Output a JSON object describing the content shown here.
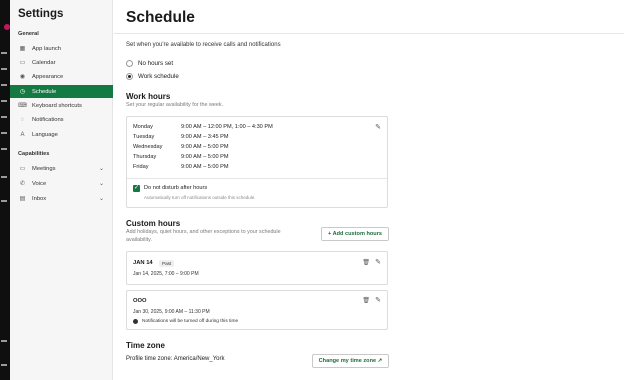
{
  "sidebar": {
    "title": "Settings",
    "sections": [
      {
        "label": "General"
      },
      {
        "label": "Capabilities"
      }
    ],
    "items": [
      {
        "label": "App launch",
        "icon": "grid-icon"
      },
      {
        "label": "Calendar",
        "icon": "calendar-icon"
      },
      {
        "label": "Appearance",
        "icon": "eye-icon"
      },
      {
        "label": "Schedule",
        "icon": "clock-icon",
        "active": true
      },
      {
        "label": "Keyboard shortcuts",
        "icon": "keyboard-icon"
      },
      {
        "label": "Notifications",
        "icon": "bell-icon"
      },
      {
        "label": "Language",
        "icon": "language-icon"
      },
      {
        "label": "Meetings",
        "icon": "video-icon"
      },
      {
        "label": "Voice",
        "icon": "phone-icon"
      },
      {
        "label": "Inbox",
        "icon": "inbox-icon"
      }
    ]
  },
  "main": {
    "title": "Schedule",
    "subtitle": "Set when you're available to receive calls and notifications",
    "options": [
      {
        "label": "No hours set",
        "selected": false
      },
      {
        "label": "Work schedule",
        "selected": true
      }
    ],
    "work_hours": {
      "heading": "Work hours",
      "subtitle": "Set your regular availability for the week.",
      "rows": [
        {
          "day": "Monday",
          "time": "9:00 AM – 12:00 PM, 1:00 – 4:30 PM"
        },
        {
          "day": "Tuesday",
          "time": "9:00 AM – 3:45 PM"
        },
        {
          "day": "Wednesday",
          "time": "9:00 AM – 5:00 PM"
        },
        {
          "day": "Thursday",
          "time": "9:00 AM – 5:00 PM"
        },
        {
          "day": "Friday",
          "time": "9:00 AM – 5:00 PM"
        }
      ],
      "dnd_label": "Do not disturb after hours",
      "dnd_sub": "Automatically turn off notifications outside this schedule.",
      "dnd_checked": true
    },
    "custom_hours": {
      "heading": "Custom hours",
      "subtitle_line1": "Add holidays, quiet hours, and other exceptions to your schedule",
      "subtitle_line2": "availability.",
      "add_button": "+ Add custom hours",
      "entries": [
        {
          "title": "JAN 14",
          "badge": "Past",
          "date": "Jan 14, 2025, 7:00 – 9:00 PM"
        },
        {
          "title": "OOO",
          "date": "Jan 30, 2025, 9:00 AM – 11:30 PM",
          "note": "Notifications will be turned off during this time"
        }
      ]
    },
    "time_zone": {
      "heading": "Time zone",
      "label": "Profile time zone: America/New_York",
      "button": "Change my time zone ↗"
    }
  },
  "colors": {
    "accent": "#147a43",
    "rail": "#0f0f0f"
  }
}
